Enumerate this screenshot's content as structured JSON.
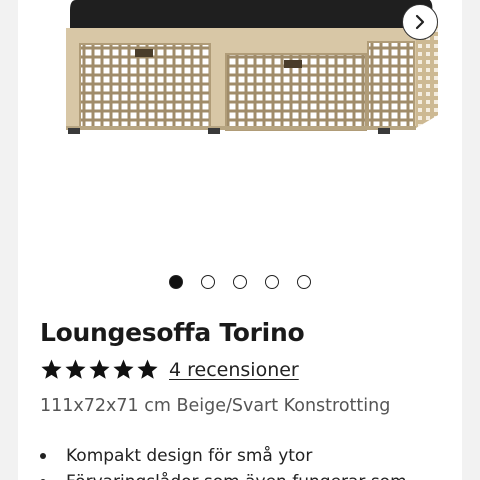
{
  "product": {
    "title": "Loungesoffa Torino",
    "rating": {
      "stars": 5,
      "max": 5
    },
    "reviews_label": "4 recensioner",
    "spec": "111x72x71 cm Beige/Svart Konstrotting",
    "features": [
      "Kompakt design för små ytor",
      "Förvaringslådor som även fungerar som"
    ]
  },
  "gallery": {
    "slide_count": 5,
    "active_slide": 1
  },
  "colors": {
    "rattan": "#d8c7a6",
    "cushion": "#1f1f1f",
    "star": "#111111"
  },
  "icons": {
    "next": "chevron-right-icon",
    "rating": "star-icon"
  }
}
